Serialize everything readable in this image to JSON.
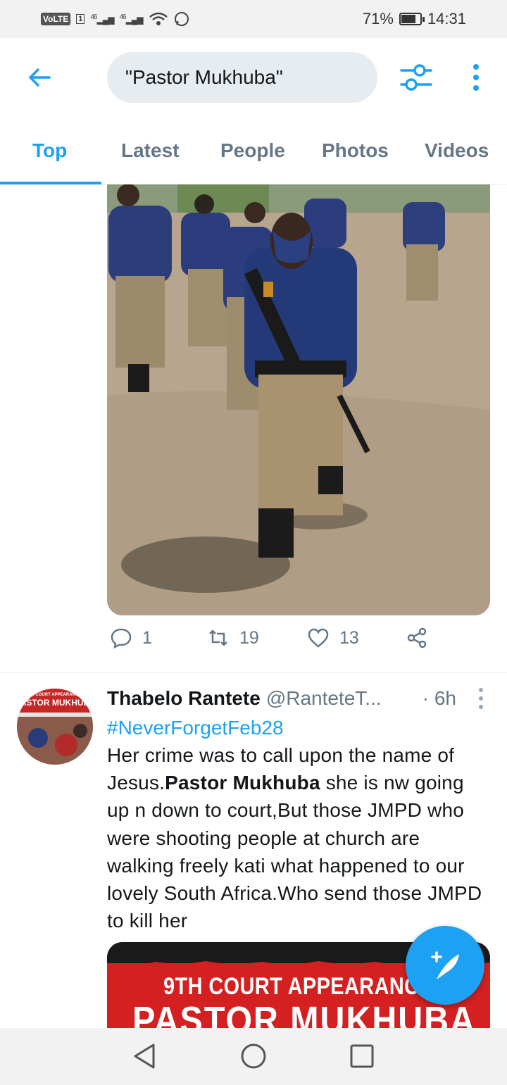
{
  "status_bar": {
    "left_badges": [
      "VoLTE",
      "1"
    ],
    "signal1": "46",
    "signal2": "46",
    "battery": "71%",
    "battery_level": 0.71,
    "time": "14:31"
  },
  "header": {
    "search_query": "\"Pastor Mukhuba\"",
    "icons": [
      "back-arrow-icon",
      "filter-sliders-icon",
      "more-vertical-icon"
    ]
  },
  "tabs": [
    {
      "label": "Top",
      "active": true
    },
    {
      "label": "Latest",
      "active": false
    },
    {
      "label": "People",
      "active": false
    },
    {
      "label": "Photos",
      "active": false
    },
    {
      "label": "Videos",
      "active": false
    }
  ],
  "tweet1": {
    "actions": {
      "replies": "1",
      "retweets": "19",
      "likes": "13"
    }
  },
  "tweet2": {
    "name": "Thabelo Rantete",
    "handle": "@RanteteT...",
    "time": "· 6h",
    "hashtag": "#NeverForgetFeb28",
    "text_before": "Her crime was to call upon the name of Jesus.",
    "text_bold": "Pastor Mukhuba",
    "text_after": " she is nw going up n down to court,But those JMPD who were shooting people at church are walking freely kati what happened to our lovely South Africa.Who send those JMPD to kill her",
    "avatar_text": "ASTOR MUKHUB",
    "avatar_subtext": "TH COURT APPEARANCE",
    "poster_line1": "9TH COURT APPEARANCE O",
    "poster_line2": "PASTOR MUKHUBA"
  },
  "colors": {
    "accent": "#1da1f2",
    "muted": "#657786",
    "text": "#14171a"
  }
}
